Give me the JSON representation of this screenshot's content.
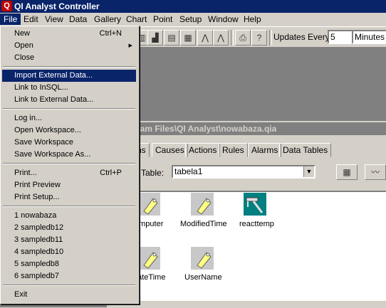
{
  "app": {
    "title": "QI Analyst Controller",
    "icon_letter": "Q"
  },
  "menubar": [
    "File",
    "Edit",
    "View",
    "Data",
    "Gallery",
    "Chart",
    "Point",
    "Setup",
    "Window",
    "Help"
  ],
  "toolbar": {
    "updates_label": "Updates Every:",
    "updates_value": "5",
    "units_value": "Minutes"
  },
  "child_window": {
    "title_partial": "ram Files\\QI Analyst\\nowabaza.qia",
    "tabs": [
      "ns",
      "Causes",
      "Actions",
      "Rules",
      "Alarms",
      "Data Tables"
    ],
    "table_label": "Table:",
    "table_value": "tabela1",
    "fields": [
      {
        "label": "omputer",
        "icon": "tag-icon"
      },
      {
        "label": "ModifiedTime",
        "icon": "tag-icon"
      },
      {
        "label": "reacttemp",
        "icon": "caliper-icon"
      },
      {
        "label": "eateTime",
        "icon": "tag-icon"
      },
      {
        "label": "UserName",
        "icon": "tag-icon"
      }
    ]
  },
  "file_menu": {
    "items": [
      {
        "label": "New",
        "shortcut": "Ctrl+N"
      },
      {
        "label": "Open",
        "submenu": "▸"
      },
      {
        "label": "Close"
      },
      {
        "label": "Import External Data...",
        "highlighted": true
      },
      {
        "label": "Link to InSQL..."
      },
      {
        "label": "Link to External Data..."
      },
      {
        "label": "Log in..."
      },
      {
        "label": "Open Workspace..."
      },
      {
        "label": "Save Workspace"
      },
      {
        "label": "Save Workspace As..."
      },
      {
        "label": "Print...",
        "shortcut": "Ctrl+P"
      },
      {
        "label": "Print Preview"
      },
      {
        "label": "Print Setup..."
      },
      {
        "label": "1 nowabaza"
      },
      {
        "label": "2 sampledb12"
      },
      {
        "label": "3 sampledb11"
      },
      {
        "label": "4 sampledb10"
      },
      {
        "label": "5 sampledb8"
      },
      {
        "label": "6 sampledb7"
      },
      {
        "label": "Exit"
      }
    ]
  }
}
